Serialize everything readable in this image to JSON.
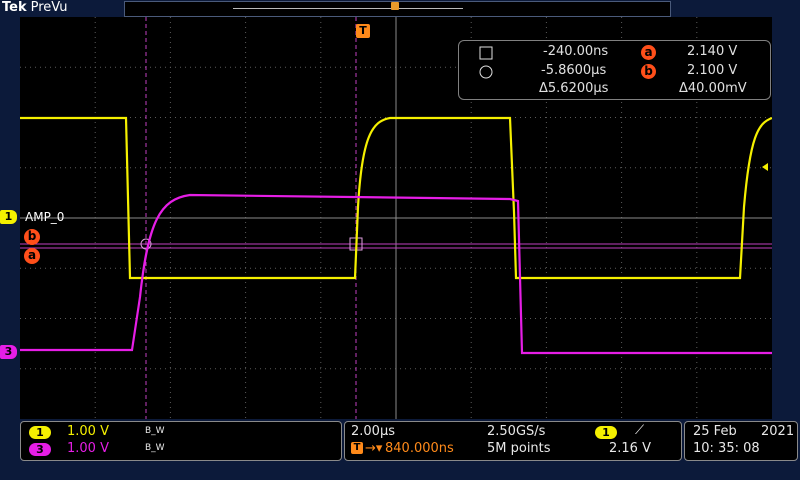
{
  "header": {
    "brand": "Tek",
    "mode": "PreVu"
  },
  "channels": {
    "ch1": {
      "number": "1",
      "scale": "1.00 V",
      "bw": "B_W",
      "label": "AMP_0",
      "color": "#f5f000"
    },
    "ch3": {
      "number": "3",
      "scale": "1.00 V",
      "bw": "B_W",
      "color": "#e61ee6"
    }
  },
  "cursors": {
    "a_label": "a",
    "b_label": "b",
    "row1": {
      "time": "-240.00ns",
      "volt": "2.140 V"
    },
    "row2": {
      "time": "-5.8600µs",
      "volt": "2.100 V"
    },
    "delta_time": "Δ5.6200µs",
    "delta_volt": "Δ40.00mV"
  },
  "trigger": {
    "marker": "T",
    "source": "1",
    "slope": "⟋",
    "level": "2.16 V"
  },
  "timebase": {
    "scale": "2.00µs",
    "sample_rate": "2.50GS/s",
    "position": "840.000ns",
    "record_length": "5M points"
  },
  "datetime": {
    "date_day": "25 Feb",
    "year": "2021",
    "time": "10: 35: 08"
  },
  "colors": {
    "ch1": "#f5f000",
    "ch3": "#e61ee6",
    "cursor": "#ff4f1a",
    "trigger": "#ff8a1a",
    "grid": "#5a5a5a"
  }
}
